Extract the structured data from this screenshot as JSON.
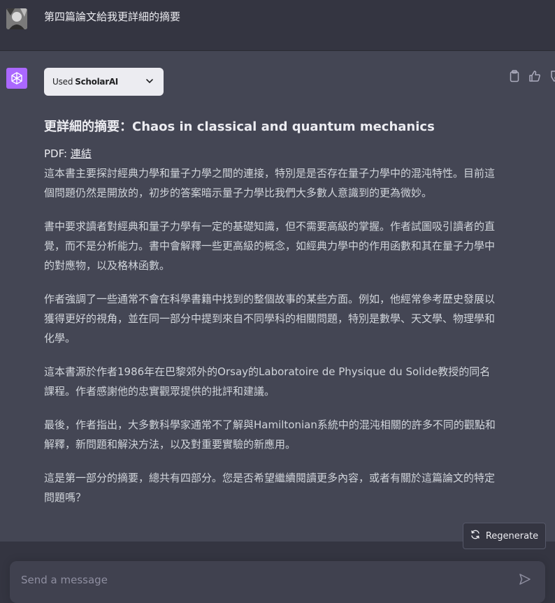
{
  "user": {
    "message": "第四篇論文給我更詳細的摘要"
  },
  "plugin": {
    "used_label": "Used",
    "name": "ScholarAI"
  },
  "response": {
    "heading": "更詳細的摘要：Chaos in classical and quantum mechanics",
    "pdf_label": "PDF: ",
    "pdf_link": "連結",
    "paragraphs": [
      "這本書主要探討經典力學和量子力學之間的連接，特別是是否存在量子力學中的混沌特性。目前這個問題仍然是開放的，初步的答案暗示量子力學比我們大多數人意識到的更為微妙。",
      "書中要求讀者對經典和量子力學有一定的基礎知識，但不需要高級的掌握。作者試圖吸引讀者的直覺，而不是分析能力。書中會解釋一些更高級的概念，如經典力學中的作用函數和其在量子力學中的對應物，以及格林函數。",
      "作者強調了一些通常不會在科學書籍中找到的整個故事的某些方面。例如，他經常參考歷史發展以獲得更好的視角，並在同一部分中提到來自不同學科的相關問題，特別是數學、天文學、物理學和化學。",
      "這本書源於作者1986年在巴黎郊外的Orsay的Laboratoire de Physique du Solide教授的同名課程。作者感謝他的忠實觀眾提供的批評和建議。",
      "最後，作者指出，大多數科學家通常不了解與Hamiltonian系統中的混沌相關的許多不同的觀點和解釋，新問題和解決方法，以及對重要實驗的新應用。",
      "這是第一部分的摘要，總共有四部分。您是否希望繼續閱讀更多內容，或者有關於這篇論文的特定問題嗎？"
    ]
  },
  "controls": {
    "regenerate_label": "Regenerate",
    "input_placeholder": "Send a message"
  },
  "colors": {
    "background": "#343541",
    "assistant_bg": "#444654",
    "gpt_avatar": "#ab68ff",
    "text": "#ececf1"
  },
  "icons": [
    "user-avatar",
    "chatgpt-logo-icon",
    "chevron-down-icon",
    "clipboard-icon",
    "thumbs-up-icon",
    "thumbs-down-icon",
    "refresh-icon",
    "send-icon"
  ]
}
